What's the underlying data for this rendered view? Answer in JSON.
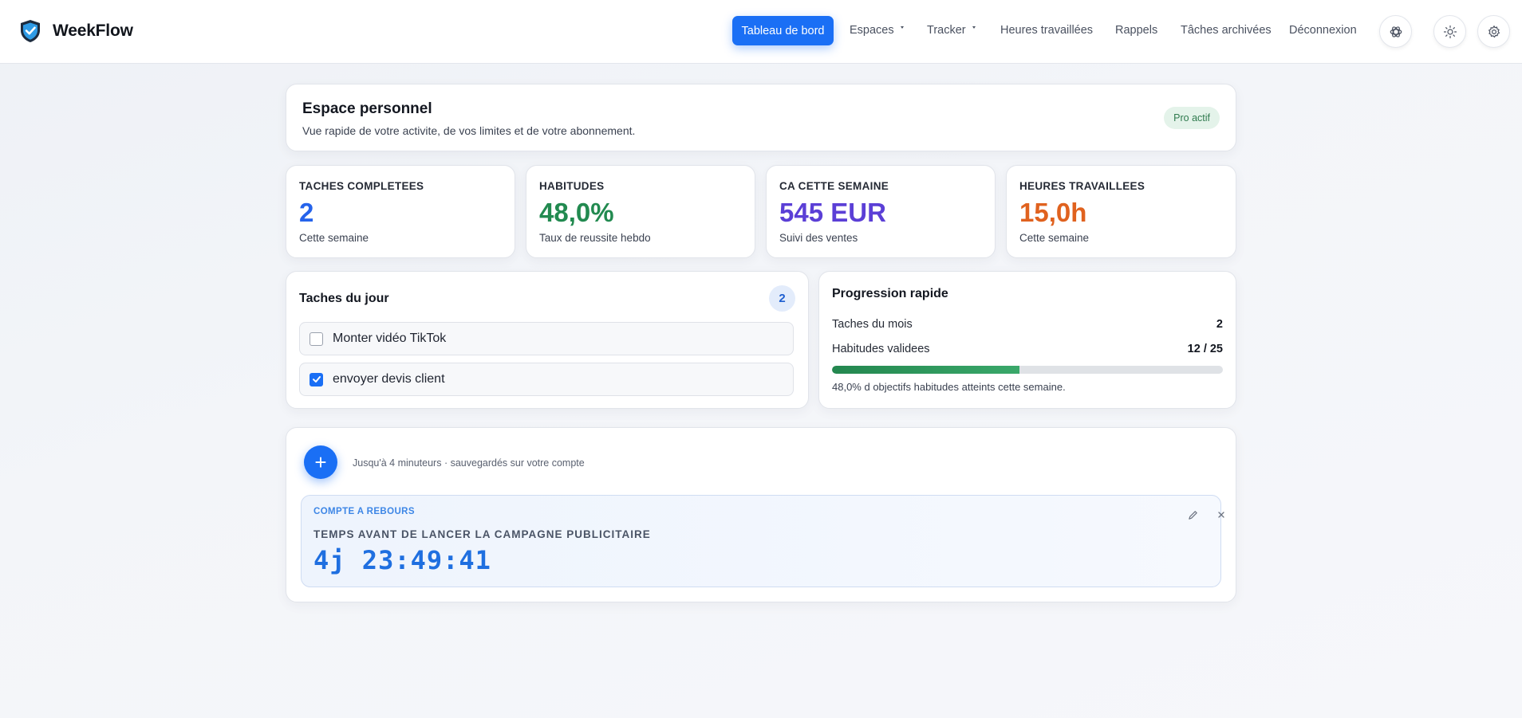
{
  "app": {
    "name": "WeekFlow"
  },
  "nav": {
    "primary": "Tableau de bord",
    "espaces": "Espaces",
    "tracker": "Tracker",
    "heures": "Heures travaillées",
    "rappels": "Rappels",
    "archives": "Tâches archivées",
    "logout": "Déconnexion"
  },
  "hero": {
    "title": "Espace personnel",
    "subtitle": "Vue rapide de votre activite, de vos limites et de votre abonnement.",
    "badge": "Pro actif"
  },
  "stats": [
    {
      "label": "TACHES COMPLETEES",
      "value": "2",
      "sub": "Cette semaine",
      "color": "#2563eb"
    },
    {
      "label": "HABITUDES",
      "value": "48,0%",
      "sub": "Taux de reussite hebdo",
      "color": "#228a50"
    },
    {
      "label": "CA CETTE SEMAINE",
      "value": "545 EUR",
      "sub": "Suivi des ventes",
      "color": "#5b3fd6"
    },
    {
      "label": "HEURES TRAVAILLEES",
      "value": "15,0h",
      "sub": "Cette semaine",
      "color": "#e0621f"
    }
  ],
  "tasks": {
    "title": "Taches du jour",
    "count": "2",
    "items": [
      {
        "text": "Monter vidéo TikTok",
        "done": false
      },
      {
        "text": "envoyer devis client",
        "done": true
      }
    ]
  },
  "progress": {
    "title": "Progression rapide",
    "month_label": "Taches du mois",
    "month_value": "2",
    "habits_label": "Habitudes validees",
    "habits_value": "12 / 25",
    "habits_fraction": 0.48,
    "note": "48,0% d objectifs habitudes atteints cette semaine."
  },
  "timers": {
    "note": "Jusqu'à 4 minuteurs · sauvegardés sur votre compte",
    "countdown": {
      "kicker": "COMPTE A REBOURS",
      "title": "TEMPS AVANT DE LANCER LA CAMPAGNE PUBLICITAIRE",
      "time": "4j 23:49:41"
    }
  }
}
